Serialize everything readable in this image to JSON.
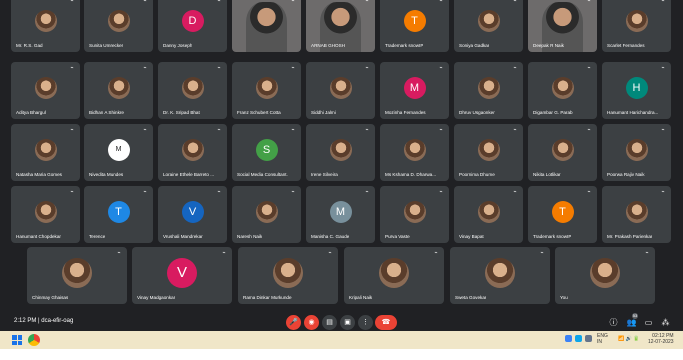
{
  "meeting": {
    "time": "2:12 PM",
    "code": "dca-efir-oag",
    "people_count": "53"
  },
  "rows": [
    [
      {
        "name": "Mr. R.S. Gad",
        "kind": "photo"
      },
      {
        "name": "Sunita Umrecker",
        "kind": "photo"
      },
      {
        "name": "Danny Joseph",
        "kind": "letter",
        "letter": "D",
        "color": "#d81b60"
      },
      {
        "name": "",
        "kind": "video"
      },
      {
        "name": "ARNAB GHOSH",
        "kind": "video"
      },
      {
        "name": "Trademark snowIP",
        "kind": "letter",
        "letter": "T",
        "color": "#f57c00"
      },
      {
        "name": "Soniya Gadkar",
        "kind": "photo"
      },
      {
        "name": "Deepak R Naik",
        "kind": "video"
      },
      {
        "name": "Scarlet Fernandes",
        "kind": "photo"
      }
    ],
    [
      {
        "name": "Aditya Bhargul",
        "kind": "photo"
      },
      {
        "name": "Bidhan A Shinkre",
        "kind": "photo"
      },
      {
        "name": "Dr. K. Sripad Bhat",
        "kind": "photo"
      },
      {
        "name": "Franz Schubert Cotta",
        "kind": "photo"
      },
      {
        "name": "Siddhi Jalmi",
        "kind": "photo"
      },
      {
        "name": "Mozinha Fernandes",
        "kind": "letter",
        "letter": "M",
        "color": "#d81b60"
      },
      {
        "name": "Dhruv Usgaonker",
        "kind": "photo"
      },
      {
        "name": "Digambar G. Parab",
        "kind": "photo"
      },
      {
        "name": "Hanumant Harichandra...",
        "kind": "letter",
        "letter": "H",
        "color": "#00897b"
      }
    ],
    [
      {
        "name": "Natasha Maria Gomes",
        "kind": "photo"
      },
      {
        "name": "Nivedita Mundes",
        "kind": "logo"
      },
      {
        "name": "Loraine Ethele Barreto ...",
        "kind": "photo"
      },
      {
        "name": "Social Media Consultant.",
        "kind": "letter",
        "letter": "S",
        "color": "#43a047"
      },
      {
        "name": "Irene Silveira",
        "kind": "photo"
      },
      {
        "name": "Ms Kshama D. Dharwa...",
        "kind": "photo"
      },
      {
        "name": "Poornima Dhume",
        "kind": "photo"
      },
      {
        "name": "Nikita Lotlikar",
        "kind": "photo"
      },
      {
        "name": "Poorwa Rajiv Naik",
        "kind": "photo"
      }
    ],
    [
      {
        "name": "Hanumant Chopdekar",
        "kind": "photo"
      },
      {
        "name": "Terence",
        "kind": "letter",
        "letter": "T",
        "color": "#1e88e5"
      },
      {
        "name": "Vrushali Mandrekar",
        "kind": "letter",
        "letter": "V",
        "color": "#1565c0"
      },
      {
        "name": "Naresh Naik",
        "kind": "photo"
      },
      {
        "name": "Manisha C. Gaude",
        "kind": "letter",
        "letter": "M",
        "color": "#78909c"
      },
      {
        "name": "Purva Vaste",
        "kind": "photo"
      },
      {
        "name": "Vinay Bapat",
        "kind": "photo"
      },
      {
        "name": "Trademark snowIP",
        "kind": "letter",
        "letter": "T",
        "color": "#f57c00"
      },
      {
        "name": "Mr. Prakash Parienkar",
        "kind": "photo"
      }
    ],
    [
      {
        "name": "Chinmay Ghaisas",
        "kind": "photo"
      },
      {
        "name": "Vinay Madgaonkar",
        "kind": "letter",
        "letter": "V",
        "color": "#d81b60"
      },
      {
        "name": "Rama Dinkar Murkunde",
        "kind": "photo"
      },
      {
        "name": "Kripali Naik",
        "kind": "photo"
      },
      {
        "name": "Sweta Govekar",
        "kind": "photo"
      },
      {
        "name": "You",
        "kind": "photo"
      }
    ]
  ],
  "controls": {
    "mic_icon": "mic-off-icon",
    "cam_icon": "camera-off-icon",
    "captions_icon": "captions-icon",
    "present_icon": "present-icon",
    "more_icon": "more-icon",
    "leave_icon": "call-end-icon"
  },
  "taskbar": {
    "lang_line1": "ENG",
    "lang_line2": "IN",
    "clock_time": "02:12 PM",
    "clock_date": "12-07-2023"
  }
}
